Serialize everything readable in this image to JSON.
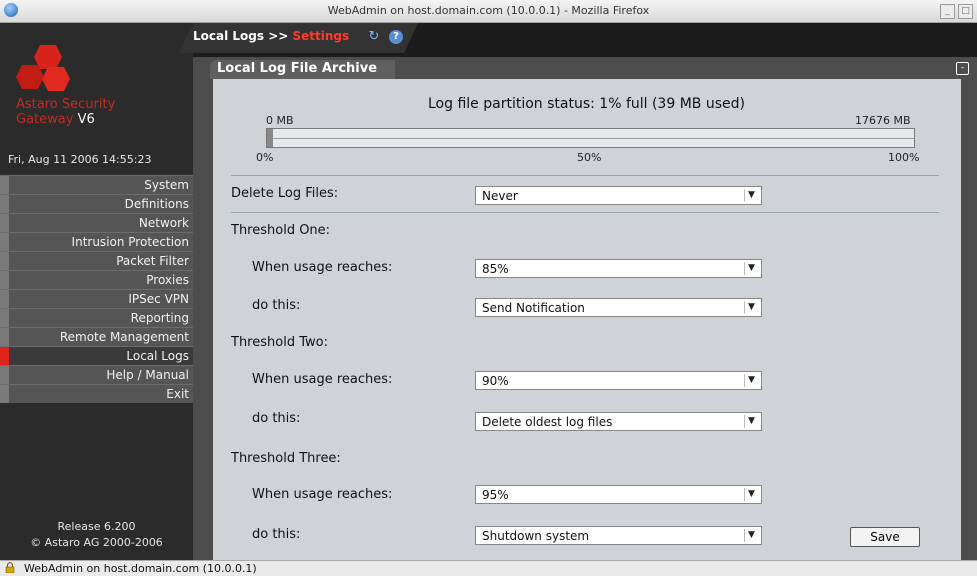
{
  "window": {
    "title": "WebAdmin on host.domain.com (10.0.0.1) - Mozilla Firefox",
    "min_symbol": "_",
    "max_symbol": "□"
  },
  "sidebar": {
    "brand_line1": "Astaro Security",
    "brand_line2": "Gateway",
    "brand_version": "V6",
    "datetime": "Fri, Aug 11 2006 14:55:23",
    "items": [
      {
        "label": "System"
      },
      {
        "label": "Definitions"
      },
      {
        "label": "Network"
      },
      {
        "label": "Intrusion Protection"
      },
      {
        "label": "Packet Filter"
      },
      {
        "label": "Proxies"
      },
      {
        "label": "IPSec VPN"
      },
      {
        "label": "Reporting"
      },
      {
        "label": "Remote Management"
      },
      {
        "label": "Local Logs",
        "active": true
      },
      {
        "label": "Help / Manual"
      },
      {
        "label": "Exit"
      }
    ],
    "release": "Release 6.200",
    "copyright": "© Astaro AG 2000-2006"
  },
  "breadcrumb": {
    "section": "Local Logs >>",
    "current": "Settings"
  },
  "panel": {
    "title": "Local Log File Archive",
    "partition_status": "Log file partition status: 1% full (39 MB used)",
    "min_label": "0 MB",
    "max_label": "17676 MB",
    "tick_0": "0%",
    "tick_50": "50%",
    "tick_100": "100%",
    "usage_fraction": 0.01,
    "delete_label": "Delete Log Files:",
    "delete_value": "Never",
    "thresholds": [
      {
        "heading": "Threshold One:",
        "usage_label": "When usage reaches:",
        "usage_value": "85%",
        "action_label": "do this:",
        "action_value": "Send Notification"
      },
      {
        "heading": "Threshold Two:",
        "usage_label": "When usage reaches:",
        "usage_value": "90%",
        "action_label": "do this:",
        "action_value": "Delete oldest log files"
      },
      {
        "heading": "Threshold Three:",
        "usage_label": "When usage reaches:",
        "usage_value": "95%",
        "action_label": "do this:",
        "action_value": "Shutdown system"
      }
    ],
    "save_label": "Save"
  },
  "statusbar": {
    "text": "WebAdmin on host.domain.com (10.0.0.1)"
  },
  "colors": {
    "accent": "#e0241c",
    "panel_bg": "#cfd3d8",
    "sidebar_bg": "#2b2b2b"
  }
}
